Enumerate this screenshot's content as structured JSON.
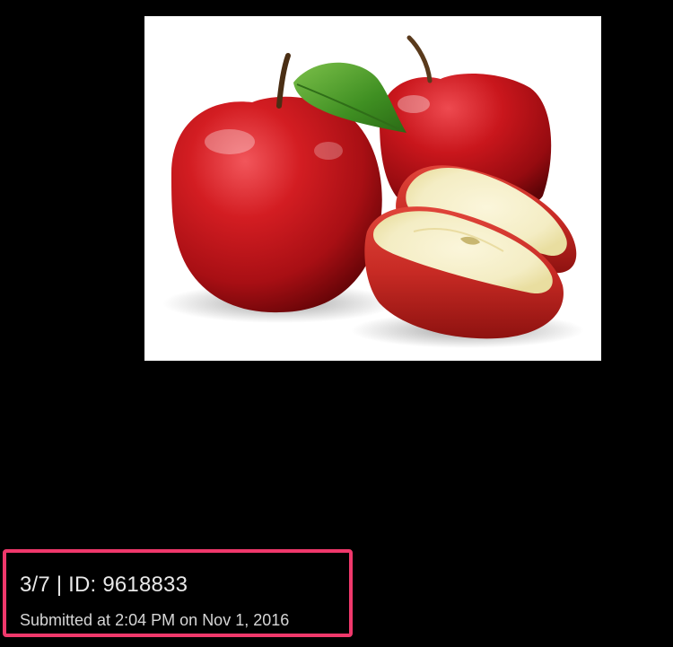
{
  "image": {
    "subject": "apples-photo",
    "background_color": "#ffffff",
    "apple_color": "#c0141a",
    "leaf_color": "#4a9a2a",
    "flesh_color": "#f6f1cf"
  },
  "info": {
    "position_label": "3/7",
    "separator": "|",
    "id_label": "ID:",
    "id_value": "9618833",
    "submitted_prefix": "Submitted at",
    "submitted_time": "2:04 PM",
    "submitted_on": "on",
    "submitted_date": "Nov 1, 2016",
    "highlight_color": "#f0386b"
  }
}
